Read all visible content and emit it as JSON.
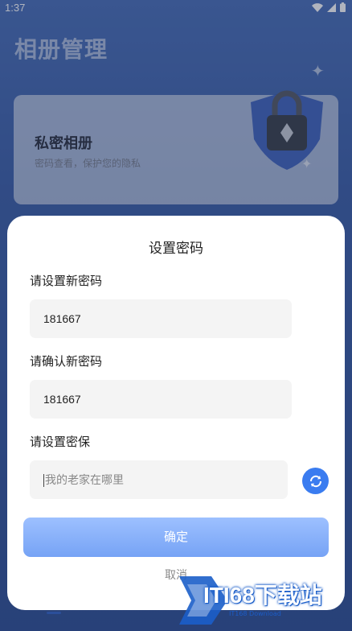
{
  "status_bar": {
    "time": "1:37"
  },
  "page": {
    "title": "相册管理"
  },
  "album_card": {
    "title": "私密相册",
    "subtitle": "密码查看，保护您的隐私"
  },
  "dialog": {
    "title": "设置密码",
    "new_password_label": "请设置新密码",
    "new_password_value": "181667",
    "confirm_password_label": "请确认新密码",
    "confirm_password_value": "181667",
    "security_label": "请设置密保",
    "security_placeholder": "我的老家在哪里",
    "confirm_button": "确定",
    "cancel_button": "取消"
  },
  "watermark": {
    "text": "ITI68下载站",
    "small": "IT168 Download"
  },
  "colors": {
    "accent": "#3a7cf0",
    "confirm_top": "#9dc0ff",
    "confirm_bottom": "#76a3f5"
  }
}
